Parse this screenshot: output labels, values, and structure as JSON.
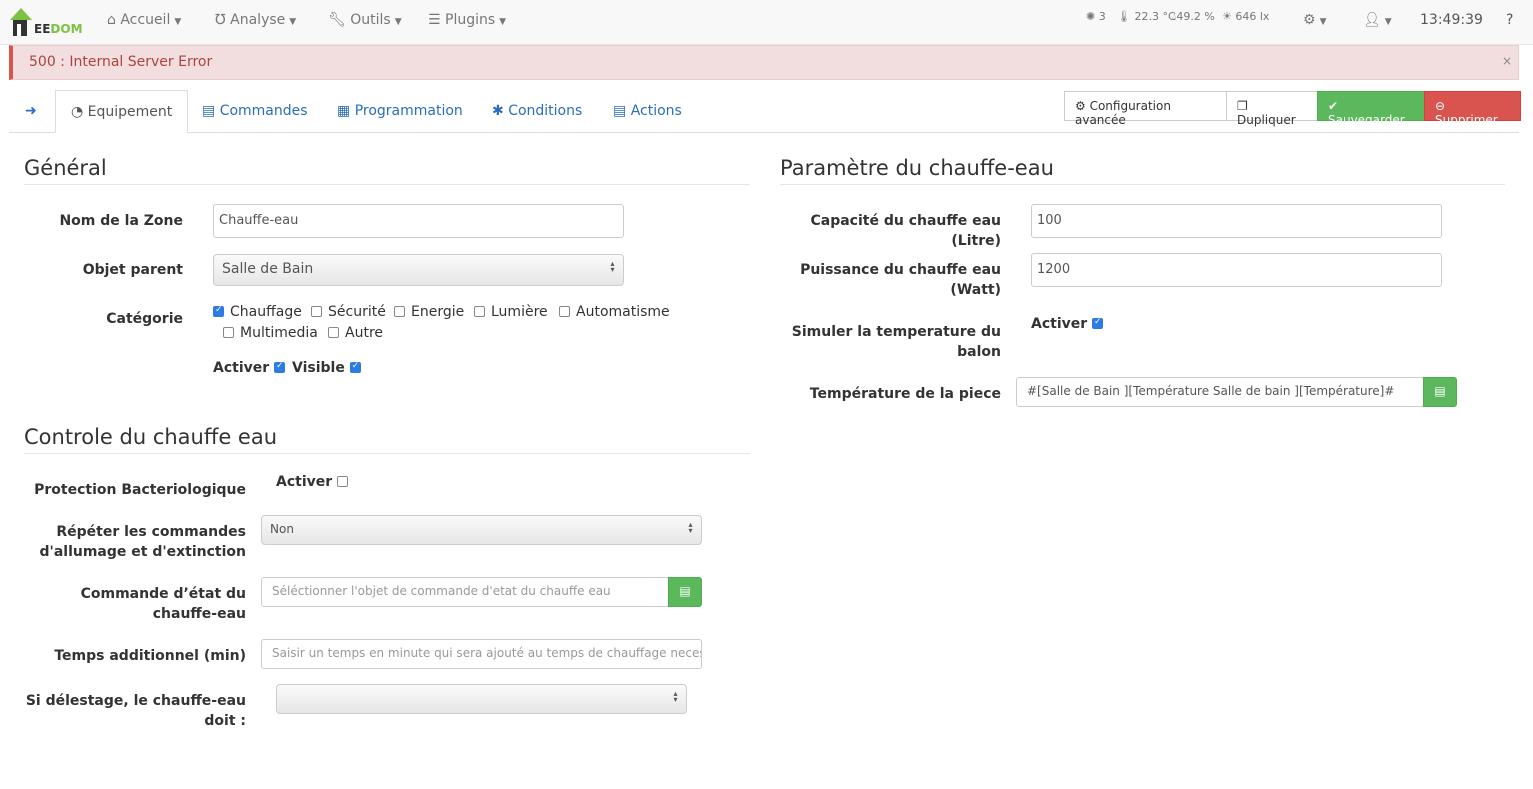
{
  "nav": {
    "logo": "JEEDOM",
    "menu": [
      {
        "icon": "home-icon",
        "label": "Accueil"
      },
      {
        "icon": "stethoscope-icon",
        "label": "Analyse"
      },
      {
        "icon": "wrench-icon",
        "label": "Outils"
      },
      {
        "icon": "tasks-icon",
        "label": "Plugins"
      }
    ],
    "status": {
      "lights": "3",
      "temperature": "22.3 °C",
      "humidity": "49.2 %",
      "luminosity": "646 lx"
    },
    "time": "13:49:39"
  },
  "alert": {
    "text": "500 : Internal Server Error",
    "close": "×"
  },
  "tabs": [
    {
      "label": "Equipement",
      "active": true
    },
    {
      "label": "Commandes"
    },
    {
      "label": "Programmation"
    },
    {
      "label": "Conditions"
    },
    {
      "label": "Actions"
    }
  ],
  "actions": {
    "config": "Configuration avancée",
    "dup": "Dupliquer",
    "save": "Sauvegarder",
    "del": "Supprimer"
  },
  "general": {
    "title": "Général",
    "name_label": "Nom de la Zone",
    "name_value": "Chauffe-eau",
    "parent_label": "Objet parent",
    "parent_value": "Salle de Bain",
    "cat_label": "Catégorie",
    "categories": [
      {
        "label": "Chauffage",
        "checked": true
      },
      {
        "label": "Sécurité",
        "checked": false
      },
      {
        "label": "Energie",
        "checked": false
      },
      {
        "label": "Lumière",
        "checked": false
      },
      {
        "label": "Automatisme",
        "checked": false
      },
      {
        "label": "Multimedia",
        "checked": false
      },
      {
        "label": "Autre",
        "checked": false
      }
    ],
    "activer": "Activer",
    "visible": "Visible"
  },
  "controle": {
    "title": "Controle du chauffe eau",
    "prot_label": "Protection Bacteriologique",
    "prot_check": "Activer",
    "rep_label": "Répéter les commandes d'allumage et d'extinction",
    "rep_value": "Non",
    "etat_label": "Commande d’état du chauffe-eau",
    "etat_ph": "Séléctionner l'objet de commande d'etat du chauffe eau",
    "temps_label": "Temps additionnel (min)",
    "temps_ph": "Saisir un temps en minute qui sera ajouté au temps de chauffage necessai",
    "del_label": "Si délestage, le chauffe-eau doit :",
    "del_value": ""
  },
  "param": {
    "title": "Paramètre du chauffe-eau",
    "cap_label": "Capacité du chauffe eau (Litre)",
    "cap_value": "100",
    "puis_label": "Puissance du chauffe eau (Watt)",
    "puis_value": "1200",
    "sim_label": "Simuler la temperature du balon",
    "sim_check": "Activer",
    "temp_label": "Température de la piece",
    "temp_value": "#[Salle de Bain ][Température Salle de bain ][Température]#"
  }
}
